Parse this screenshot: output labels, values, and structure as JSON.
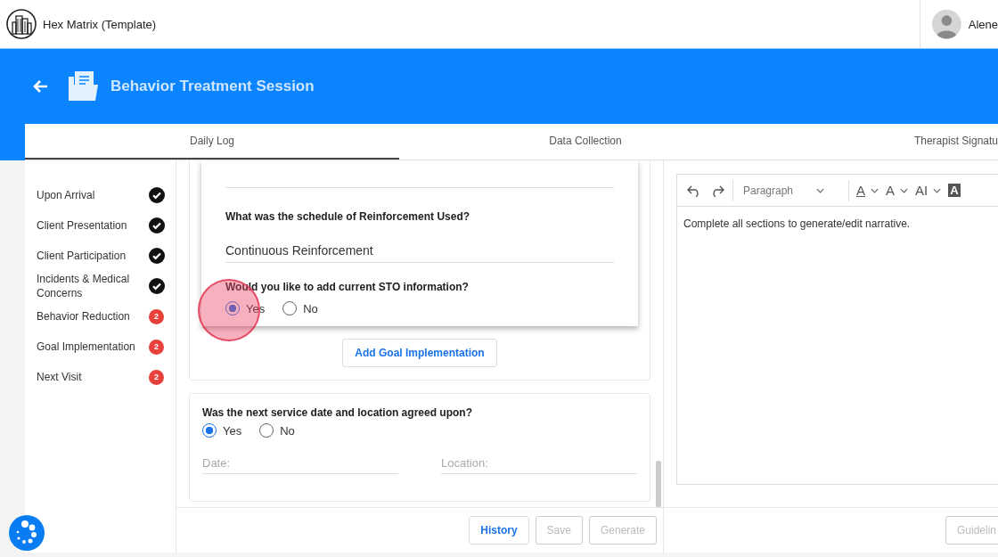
{
  "app": {
    "title": "Hex Matrix (Template)",
    "user": "Alene"
  },
  "page": {
    "title": "Behavior Treatment Session"
  },
  "tabs": [
    {
      "label": "Daily Log",
      "selected": true
    },
    {
      "label": "Data Collection",
      "selected": false
    },
    {
      "label": "Therapist Signatu",
      "selected": false
    }
  ],
  "sidebar": {
    "items": [
      {
        "label": "Upon Arrival",
        "kind": "done"
      },
      {
        "label": "Client Presentation",
        "kind": "done"
      },
      {
        "label": "Client Participation",
        "kind": "done"
      },
      {
        "label": "Incidents & Medical Concerns",
        "kind": "done"
      },
      {
        "label": "Behavior Reduction",
        "kind": "count",
        "count": "2"
      },
      {
        "label": "Goal Implementation",
        "kind": "count",
        "count": "2"
      },
      {
        "label": "Next Visit",
        "kind": "count",
        "count": "2"
      }
    ]
  },
  "goal_card": {
    "schedule_question": "What was the schedule of Reinforcement Used?",
    "schedule_value": "Continuous Reinforcement",
    "sto_question": "Would you like to add current STO information?",
    "sto_options": [
      {
        "label": "Yes",
        "selected": true
      },
      {
        "label": "No",
        "selected": false
      }
    ],
    "add_button": "Add Goal Implementation"
  },
  "next_visit": {
    "question": "Was the next service date and location agreed upon?",
    "options": [
      {
        "label": "Yes",
        "selected": true
      },
      {
        "label": "No",
        "selected": false
      }
    ],
    "date": {
      "placeholder": "Date:"
    },
    "location": {
      "placeholder": "Location:"
    }
  },
  "footer_buttons": [
    {
      "label": "History",
      "disabled": false
    },
    {
      "label": "Save",
      "disabled": true
    },
    {
      "label": "Generate",
      "disabled": true
    }
  ],
  "editor": {
    "format": "Paragraph",
    "text": "Complete all sections to generate/edit narrative.",
    "tools": [
      {
        "kind": "font-color",
        "glyph": "A"
      },
      {
        "kind": "font-style",
        "glyph": "A"
      },
      {
        "kind": "font-size",
        "glyph": "AI"
      },
      {
        "kind": "highlight",
        "glyph": "A"
      }
    ]
  },
  "right_footer_buttons": [
    {
      "label": "Guidelin",
      "disabled": true
    }
  ]
}
